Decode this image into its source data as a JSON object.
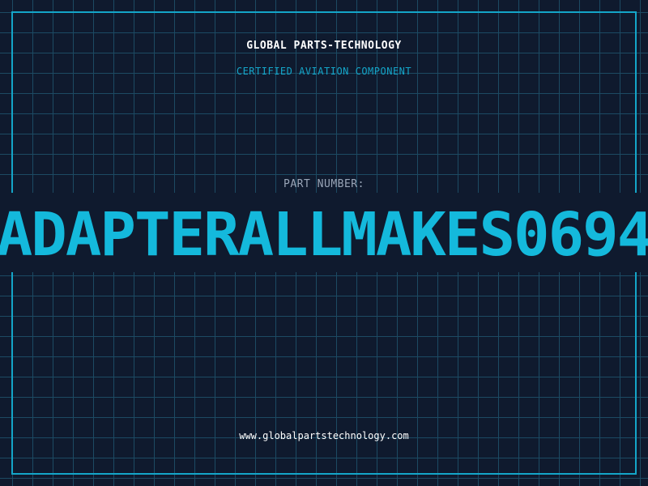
{
  "header": {
    "company": "GLOBAL PARTS-TECHNOLOGY",
    "tagline": "CERTIFIED AVIATION COMPONENT"
  },
  "part": {
    "label": "PART NUMBER:",
    "number": "ADAPTERALLMAKES0694"
  },
  "footer": {
    "website": "www.globalpartstechnology.com"
  },
  "colors": {
    "background": "#0f1a2e",
    "grid": "#1c4a63",
    "accent": "#14a5c8",
    "part_number": "#14b9dc"
  }
}
